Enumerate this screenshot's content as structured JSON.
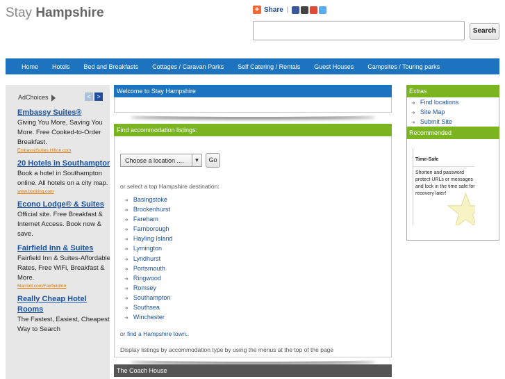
{
  "site": {
    "title_light": "Stay",
    "title_bold": "Hampshire"
  },
  "share": {
    "label": "Share",
    "separator": "|",
    "icons": [
      "facebook-icon",
      "myspace-icon",
      "google-icon",
      "twitter-icon"
    ]
  },
  "search": {
    "value": "",
    "button_label": "Search"
  },
  "nav": {
    "items": [
      "Home",
      "Hotels",
      "Bed and Breakfasts",
      "Cottages / Caravan Parks",
      "Self Catering / Rentals",
      "Guest Houses",
      "Campsites / Touring parks"
    ]
  },
  "ads": {
    "choices_label": "AdChoices",
    "prev_label": "<",
    "next_label": ">",
    "items": [
      {
        "title": "Embassy Suites®",
        "text": "Giving You More, Saving You More. Free Cooked-to-Order Breakfast.",
        "url": "EmbassySuites.Hilton.com"
      },
      {
        "title": "20 Hotels in Southampton",
        "text": "Book a hotel in Southampton online. All hotels on a city map.",
        "url": "www.booking.com"
      },
      {
        "title": "Econo Lodge® & Suites",
        "text": "Official site. Free Breakfast & Internet Access. Book now & save.",
        "url": ""
      },
      {
        "title": "Fairfield Inn & Suites",
        "text": "Fairfield Inn & Suites-Affordable Rates, Free WiFi, Breakfast & More.",
        "url": "Marriott.com/FairfieldInn"
      },
      {
        "title": "Really Cheap Hotel Rooms",
        "text": "The Fastest, Easiest, Cheapest Way to Search",
        "url": ""
      }
    ]
  },
  "welcome": {
    "title": "Welcome to Stay Hampshire"
  },
  "listings": {
    "title": "Find accommodation listings:",
    "select_value": "Choose a location ....",
    "go_label": "Go",
    "top_dest_text": "or select a top Hampshire destination:",
    "destinations": [
      "Basingstoke",
      "Brockenhurst",
      "Fareham",
      "Farnborough",
      "Hayling Island",
      "Lymington",
      "Lyndhurst",
      "Portsmouth",
      "Ringwood",
      "Romsey",
      "Southampton",
      "Southsea",
      "Winchester"
    ],
    "or_prefix": "or",
    "find_town_link": "find a Hampshire town..",
    "footer_text": "Display listings by accommodation type by using the menus at the top of the page"
  },
  "coach_house": {
    "title": "The Coach House"
  },
  "extras": {
    "title": "Extras",
    "links": [
      "Find locations",
      "Site Map",
      "Submit Site"
    ]
  },
  "recommended": {
    "title": "Recommended",
    "card_title": "Time-Safe",
    "card_text": "Shorten and password protect URLs or messages and lock in the time safe for recovery later!"
  },
  "colors": {
    "nav_blue": "#1e73be",
    "header_green": "#7ab521",
    "coach_gray": "#555555",
    "link_blue": "#1a52a0",
    "ad_url_orange": "#e47a00"
  }
}
